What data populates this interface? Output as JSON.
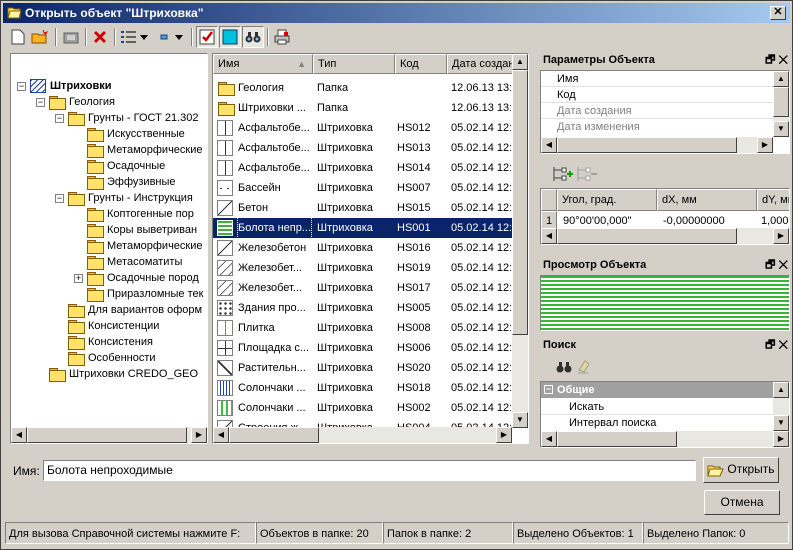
{
  "window": {
    "title": "Открыть объект \"Штриховка\"",
    "close": "✕"
  },
  "toolbar": {
    "icons": [
      "new-icon",
      "open-icon",
      "folder-up-icon",
      "delete-icon",
      "view-list-icon",
      "dropdown-icon",
      "small-icon",
      "dropdown-icon",
      "check-icon",
      "frame-icon",
      "find-icon",
      "print-icon"
    ]
  },
  "tree": {
    "items": [
      {
        "label": "Штриховки",
        "indent": 0,
        "expander": "−",
        "bold": true,
        "icon": "hatch"
      },
      {
        "label": "Геология",
        "indent": 1,
        "expander": "−"
      },
      {
        "label": "Грунты - ГОСТ 21.302",
        "indent": 2,
        "expander": "−"
      },
      {
        "label": "Искусственные",
        "indent": 3,
        "expander": ""
      },
      {
        "label": "Метаморфические",
        "indent": 3,
        "expander": ""
      },
      {
        "label": "Осадочные",
        "indent": 3,
        "expander": ""
      },
      {
        "label": "Эффузивные",
        "indent": 3,
        "expander": ""
      },
      {
        "label": "Грунты - Инструкция",
        "indent": 2,
        "expander": "−"
      },
      {
        "label": "Коптогенные пор",
        "indent": 3,
        "expander": ""
      },
      {
        "label": "Коры выветриван",
        "indent": 3,
        "expander": ""
      },
      {
        "label": "Метаморфические",
        "indent": 3,
        "expander": ""
      },
      {
        "label": "Метасоматиты",
        "indent": 3,
        "expander": ""
      },
      {
        "label": "Осадочные пород",
        "indent": 3,
        "expander": "+"
      },
      {
        "label": "Приразломные тек",
        "indent": 3,
        "expander": ""
      },
      {
        "label": "Для вариантов оформ",
        "indent": 2,
        "expander": ""
      },
      {
        "label": "Консистенции",
        "indent": 2,
        "expander": ""
      },
      {
        "label": "Консистения",
        "indent": 2,
        "expander": ""
      },
      {
        "label": "Особенности",
        "indent": 2,
        "expander": ""
      },
      {
        "label": "Штриховки CREDO_GEO",
        "indent": 1,
        "expander": ""
      }
    ]
  },
  "list": {
    "columns": [
      "Имя",
      "Тип",
      "Код",
      "Дата создан"
    ],
    "sort_arrow": "▲",
    "rows": [
      {
        "name": "Геология",
        "type": "Папка",
        "code": "",
        "date": "12.06.13 13:",
        "icon": "folder"
      },
      {
        "name": "Штриховки ...",
        "type": "Папка",
        "code": "",
        "date": "12.06.13 13:",
        "icon": "folder"
      },
      {
        "name": "Асфальтобе...",
        "type": "Штриховка",
        "code": "HS012",
        "date": "05.02.14 12:",
        "icon": "vline"
      },
      {
        "name": "Асфальтобе...",
        "type": "Штриховка",
        "code": "HS013",
        "date": "05.02.14 12:",
        "icon": "vline"
      },
      {
        "name": "Асфальтобе...",
        "type": "Штриховка",
        "code": "HS014",
        "date": "05.02.14 12:",
        "icon": "vline"
      },
      {
        "name": "Бассейн",
        "type": "Штриховка",
        "code": "HS007",
        "date": "05.02.14 12:",
        "icon": "dash"
      },
      {
        "name": "Бетон",
        "type": "Штриховка",
        "code": "HS015",
        "date": "05.02.14 12:",
        "icon": "diag"
      },
      {
        "name": "Болота непр...",
        "type": "Штриховка",
        "code": "HS001",
        "date": "05.02.14 12:",
        "icon": "green",
        "selected": true
      },
      {
        "name": "Железобетон",
        "type": "Штриховка",
        "code": "HS016",
        "date": "05.02.14 12:",
        "icon": "diag"
      },
      {
        "name": "Железобет...",
        "type": "Штриховка",
        "code": "HS019",
        "date": "05.02.14 12:",
        "icon": "diag2"
      },
      {
        "name": "Железобет...",
        "type": "Штриховка",
        "code": "HS017",
        "date": "05.02.14 12:",
        "icon": "diag2"
      },
      {
        "name": "Здания про...",
        "type": "Штриховка",
        "code": "HS005",
        "date": "05.02.14 12:",
        "icon": "dots"
      },
      {
        "name": "Плитка",
        "type": "Штриховка",
        "code": "HS008",
        "date": "05.02.14 12:",
        "icon": "tile"
      },
      {
        "name": "Площадка с...",
        "type": "Штриховка",
        "code": "HS006",
        "date": "05.02.14 12:",
        "icon": "cross"
      },
      {
        "name": "Растительн...",
        "type": "Штриховка",
        "code": "HS020",
        "date": "05.02.14 12:",
        "icon": "check"
      },
      {
        "name": "Солончаки ...",
        "type": "Штриховка",
        "code": "HS018",
        "date": "05.02.14 12:",
        "icon": "blue"
      },
      {
        "name": "Солончаки ...",
        "type": "Штриховка",
        "code": "HS002",
        "date": "05.02.14 12:",
        "icon": "lgreen"
      },
      {
        "name": "Строения ж...",
        "type": "Штриховка",
        "code": "HS004",
        "date": "05.02.14 12:",
        "icon": "diag"
      }
    ]
  },
  "params": {
    "title": "Параметры Объекта",
    "fields": [
      "Имя",
      "Код",
      "Дата создания",
      "Дата изменения"
    ],
    "grid": {
      "columns": [
        "Угол, град.",
        "dX, мм",
        "dY, мм"
      ],
      "row": [
        "1",
        "90°00'00,000\"",
        "-0,00000000",
        "1,000"
      ]
    }
  },
  "preview": {
    "title": "Просмотр Объекта",
    "color": "#3cb43c"
  },
  "search": {
    "title": "Поиск",
    "group": "Общие",
    "group_toggle": "−",
    "items": [
      "Искать",
      "Интервал поиска"
    ]
  },
  "bottom": {
    "name_label": "Имя:",
    "name_value": "Болота непроходимые",
    "open_button": "Открыть",
    "cancel_button": "Отмена"
  },
  "panel_buttons": {
    "restore": "🗗",
    "close": "✕"
  },
  "status": [
    "Для вызова Справочной системы нажмите F:",
    "Объектов в папке: 20",
    "Папок в папке: 2",
    "Выделено Объектов: 1",
    "Выделено Папок: 0"
  ]
}
